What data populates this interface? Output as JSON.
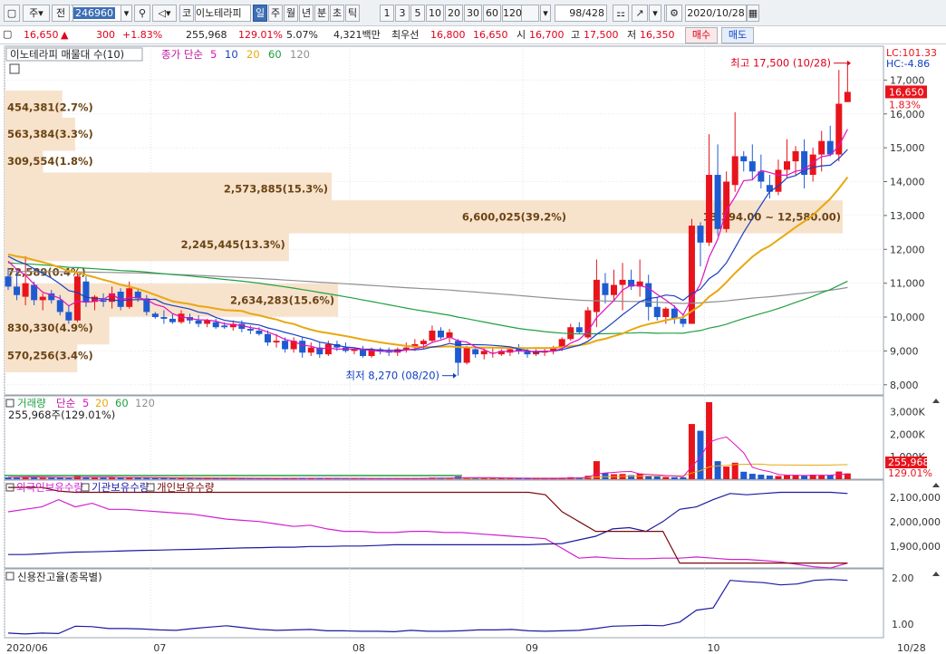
{
  "toolbar": {
    "period_select": "주",
    "view_select": "전",
    "stock_code": "246960",
    "market_button": "코",
    "stock_name": "이노테라피",
    "periods": [
      "일",
      "주",
      "월",
      "년",
      "분",
      "초",
      "틱"
    ],
    "active_period": "일",
    "intervals": [
      "1",
      "3",
      "5",
      "10",
      "20",
      "30",
      "60",
      "120"
    ],
    "count": "98",
    "total": "/428",
    "date": "2020/10/28"
  },
  "quote": {
    "price": "16,650",
    "change": "300",
    "change_pct": "+1.83%",
    "volume": "255,968",
    "volume_ratio": "129.01%",
    "turnover_pct": "5.07%",
    "amount": "4,321백만",
    "best_ask_label": "최우선",
    "best_ask": "16,800",
    "best_bid": "16,650",
    "open_label": "시",
    "open": "16,700",
    "high_label": "고",
    "high": "17,500",
    "low_label": "저",
    "low": "16,350",
    "buy_label": "매수",
    "sell_label": "매도"
  },
  "price_panel": {
    "title": "이노테라피 매물대 수(10)",
    "ma_title": "종가 단순",
    "ma_periods": [
      "5",
      "10",
      "20",
      "60",
      "120"
    ],
    "lc_label": "LC:101.33",
    "hc_label": "HC:-4.86",
    "current_price_tag": "16,650",
    "current_pct": "1.83%",
    "high_annotation": "최고 17,500 (10/28)",
    "low_annotation": "최저 8,270 (08/20)",
    "range_annotation_tail": "13,394.00 ~ 12,580.00)"
  },
  "volume_panel": {
    "title": "거래량",
    "ma_title": "단순",
    "ma_periods": [
      "5",
      "20",
      "60",
      "120"
    ],
    "summary": "255,968주(129.01%)",
    "current_tag": "255,968",
    "current_pct": "129.01%"
  },
  "holdings_panel": {
    "labels": [
      "외국인보유수량",
      "기관보유수량",
      "개인보유수량"
    ],
    "colors": [
      "#d020d0",
      "#1a1aa0",
      "#7a0a0a"
    ]
  },
  "credit_panel": {
    "title": "신용잔고율(종목별)"
  },
  "x_axis": [
    "2020/06",
    "07",
    "08",
    "09",
    "10",
    "10/28"
  ],
  "colors": {
    "up": "#e8141c",
    "down": "#1e5bd0",
    "ma5": "#e010c0",
    "ma10": "#1a3fc0",
    "ma20": "#e8a810",
    "ma60": "#20a040",
    "ma120": "#909090",
    "profile": "#f7e2cc",
    "profile_text": "#6b4413"
  },
  "chart_data": [
    {
      "type": "candlestick",
      "title": "이노테라피 매물대 수(10)",
      "y_ticks": [
        8000,
        9000,
        10000,
        11000,
        12000,
        13000,
        14000,
        15000,
        16000,
        17000
      ],
      "ylim": [
        7700,
        18000
      ],
      "candles": [
        [
          11200,
          11450,
          10800,
          10900
        ],
        [
          10900,
          11400,
          10500,
          10650
        ],
        [
          10600,
          11800,
          10350,
          11000
        ],
        [
          10950,
          11050,
          10350,
          10500
        ],
        [
          10500,
          10700,
          10200,
          10600
        ],
        [
          10700,
          10800,
          10400,
          10500
        ],
        [
          10500,
          10650,
          10050,
          10150
        ],
        [
          10150,
          10350,
          9800,
          9900
        ],
        [
          9900,
          11350,
          9850,
          11200
        ],
        [
          11050,
          11200,
          10300,
          10450
        ],
        [
          10450,
          10650,
          10200,
          10600
        ],
        [
          10500,
          10700,
          10300,
          10450
        ],
        [
          10450,
          10900,
          10250,
          10700
        ],
        [
          10750,
          10850,
          10200,
          10300
        ],
        [
          10300,
          11050,
          10250,
          10850
        ],
        [
          10750,
          10850,
          10450,
          10550
        ],
        [
          10550,
          10650,
          10050,
          10150
        ],
        [
          10100,
          10150,
          9950,
          10000
        ],
        [
          10000,
          10200,
          9800,
          9950
        ],
        [
          9950,
          10100,
          9800,
          9850
        ],
        [
          9850,
          10200,
          9800,
          10100
        ],
        [
          10000,
          10100,
          9800,
          9900
        ],
        [
          9900,
          10050,
          9700,
          9800
        ],
        [
          9800,
          9950,
          9700,
          9900
        ],
        [
          9850,
          9950,
          9650,
          9700
        ],
        [
          9750,
          9850,
          9650,
          9700
        ],
        [
          9700,
          9900,
          9600,
          9800
        ],
        [
          9800,
          9900,
          9550,
          9650
        ],
        [
          9650,
          9750,
          9500,
          9600
        ],
        [
          9600,
          9700,
          9450,
          9500
        ],
        [
          9500,
          9600,
          9150,
          9250
        ],
        [
          9250,
          9500,
          9100,
          9300
        ],
        [
          9300,
          9400,
          8950,
          9050
        ],
        [
          9050,
          9400,
          8950,
          9300
        ],
        [
          9300,
          9400,
          8800,
          8950
        ],
        [
          8950,
          9250,
          8850,
          9100
        ],
        [
          9100,
          9250,
          8800,
          8900
        ],
        [
          8900,
          9300,
          8850,
          9200
        ],
        [
          9200,
          9300,
          9000,
          9100
        ],
        [
          9100,
          9250,
          8950,
          9000
        ],
        [
          9000,
          9100,
          8900,
          9050
        ],
        [
          9050,
          9150,
          8800,
          8850
        ],
        [
          8850,
          9100,
          8800,
          9050
        ],
        [
          9050,
          9100,
          8900,
          9000
        ],
        [
          9000,
          9100,
          8850,
          8950
        ],
        [
          8950,
          9100,
          8850,
          9050
        ],
        [
          9050,
          9250,
          8950,
          9100
        ],
        [
          9100,
          9350,
          9000,
          9200
        ],
        [
          9200,
          9350,
          9050,
          9300
        ],
        [
          9300,
          9750,
          9250,
          9600
        ],
        [
          9600,
          9700,
          9350,
          9400
        ],
        [
          9400,
          9650,
          9250,
          9550
        ],
        [
          9300,
          9350,
          8270,
          8650
        ],
        [
          8650,
          9150,
          8600,
          9100
        ],
        [
          9050,
          9100,
          8800,
          8900
        ],
        [
          8900,
          9100,
          8750,
          9000
        ],
        [
          8950,
          9100,
          8800,
          8950
        ],
        [
          8900,
          9050,
          8850,
          9000
        ],
        [
          8950,
          9100,
          8850,
          9050
        ],
        [
          9050,
          9200,
          8900,
          9000
        ],
        [
          9000,
          9050,
          8800,
          8900
        ],
        [
          8900,
          9050,
          8850,
          9000
        ],
        [
          8950,
          9100,
          8850,
          9000
        ],
        [
          9000,
          9150,
          8900,
          9100
        ],
        [
          9100,
          9400,
          9000,
          9350
        ],
        [
          9350,
          9800,
          9300,
          9700
        ],
        [
          9700,
          9850,
          9500,
          9550
        ],
        [
          9400,
          10300,
          9350,
          10200
        ],
        [
          10150,
          11700,
          9700,
          11100
        ],
        [
          11000,
          11300,
          10400,
          10650
        ],
        [
          10650,
          11400,
          10500,
          10950
        ],
        [
          10950,
          11600,
          10200,
          11100
        ],
        [
          11100,
          11400,
          10800,
          10900
        ],
        [
          10900,
          11700,
          10600,
          11050
        ],
        [
          11000,
          11250,
          9900,
          10300
        ],
        [
          10300,
          10600,
          9900,
          10000
        ],
        [
          10000,
          10300,
          9800,
          10250
        ],
        [
          10250,
          10350,
          9800,
          9950
        ],
        [
          9950,
          10100,
          9700,
          9800
        ],
        [
          9800,
          12900,
          9800,
          12700
        ],
        [
          12700,
          12800,
          11500,
          12200
        ],
        [
          12200,
          15400,
          12100,
          14200
        ],
        [
          14200,
          15100,
          12400,
          12600
        ],
        [
          12600,
          14300,
          12500,
          14000
        ],
        [
          13900,
          16050,
          13700,
          14750
        ],
        [
          14750,
          14900,
          14300,
          14600
        ],
        [
          14600,
          15100,
          14050,
          14300
        ],
        [
          14300,
          14800,
          13800,
          14000
        ],
        [
          13900,
          14200,
          13500,
          13700
        ],
        [
          13700,
          14650,
          13600,
          14350
        ],
        [
          14350,
          15250,
          14100,
          14600
        ],
        [
          14600,
          15050,
          14200,
          14900
        ],
        [
          14900,
          15250,
          13800,
          14200
        ],
        [
          14200,
          15000,
          14000,
          14800
        ],
        [
          14800,
          15500,
          14300,
          15200
        ],
        [
          15200,
          15650,
          14750,
          14800
        ],
        [
          14800,
          17300,
          14600,
          16300
        ],
        [
          16350,
          17500,
          16350,
          16650
        ]
      ],
      "volume_profile": [
        {
          "label": "454,381(2.7%)",
          "price": 16200
        },
        {
          "label": "563,384(3.3%)",
          "price": 15400
        },
        {
          "label": "309,554(1.8%)",
          "price": 14600
        },
        {
          "label": "2,573,885(15.3%)",
          "price": 13780
        },
        {
          "label": "6,600,025(39.2%)",
          "price": 12960
        },
        {
          "label": "2,245,445(13.3%)",
          "price": 12140
        },
        {
          "label": "72,589(0.4%)",
          "price": 11320
        },
        {
          "label": "2,634,283(15.6%)",
          "price": 10500
        },
        {
          "label": "830,330(4.9%)",
          "price": 9680
        },
        {
          "label": "570,256(3.4%)",
          "price": 8860
        }
      ]
    },
    {
      "type": "bar",
      "title": "거래량",
      "y_ticks": [
        1000,
        2000,
        3000
      ],
      "y_tick_labels": [
        "1,000K",
        "2,000K",
        "3,000K"
      ],
      "values_k": [
        80,
        90,
        110,
        100,
        60,
        70,
        60,
        50,
        150,
        90,
        70,
        60,
        80,
        70,
        90,
        60,
        55,
        45,
        50,
        40,
        45,
        40,
        35,
        40,
        35,
        35,
        40,
        35,
        30,
        30,
        35,
        35,
        40,
        45,
        45,
        35,
        35,
        45,
        35,
        35,
        30,
        35,
        35,
        30,
        30,
        30,
        35,
        40,
        40,
        70,
        50,
        50,
        120,
        80,
        60,
        50,
        45,
        40,
        40,
        40,
        35,
        35,
        35,
        40,
        55,
        90,
        70,
        150,
        800,
        270,
        220,
        230,
        180,
        250,
        160,
        120,
        100,
        90,
        80,
        2450,
        2150,
        3420,
        800,
        560,
        730,
        330,
        240,
        200,
        160,
        140,
        170,
        190,
        160,
        200,
        170,
        180,
        340,
        256
      ]
    },
    {
      "type": "line",
      "series": [
        {
          "name": "외국인보유수량",
          "values": [
            2040000,
            2050000,
            2060000,
            2090000,
            2060000,
            2075000,
            2050000,
            2050000,
            2045000,
            2040000,
            2035000,
            2030000,
            2020000,
            2010000,
            2005000,
            2000000,
            1990000,
            1980000,
            1985000,
            1970000,
            1960000,
            1960000,
            1955000,
            1955000,
            1960000,
            1960000,
            1955000,
            1955000,
            1950000,
            1945000,
            1940000,
            1935000,
            1930000,
            1890000,
            1850000,
            1855000,
            1850000,
            1848000,
            1848000,
            1850000,
            1850000,
            1855000,
            1850000,
            1845000,
            1845000,
            1840000,
            1835000,
            1825000,
            1815000,
            1810000,
            1830000
          ]
        },
        {
          "name": "기관보유수량",
          "values": [
            1865000,
            1865000,
            1868000,
            1872000,
            1875000,
            1876000,
            1878000,
            1880000,
            1882000,
            1883000,
            1885000,
            1886000,
            1888000,
            1890000,
            1892000,
            1893000,
            1895000,
            1895000,
            1898000,
            1898000,
            1900000,
            1900000,
            1902000,
            1905000,
            1905000,
            1905000,
            1905000,
            1905000,
            1905000,
            1905000,
            1905000,
            1905000,
            1908000,
            1910000,
            1925000,
            1940000,
            1970000,
            1975000,
            1960000,
            2000000,
            2050000,
            2060000,
            2090000,
            2115000,
            2110000,
            2115000,
            2120000,
            2120000,
            2120000,
            2120000,
            2115000
          ]
        },
        {
          "name": "개인보유수량",
          "values": [
            2140000,
            2140000,
            2140000,
            2125000,
            2120000,
            2120000,
            2120000,
            2120000,
            2120000,
            2120000,
            2120000,
            2120000,
            2120000,
            2120000,
            2120000,
            2120000,
            2120000,
            2120000,
            2120000,
            2120000,
            2120000,
            2120000,
            2120000,
            2120000,
            2120000,
            2120000,
            2120000,
            2120000,
            2120000,
            2120000,
            2120000,
            2120000,
            2110000,
            2040000,
            2000000,
            1960000,
            1960000,
            1960000,
            1960000,
            1960000,
            1830000,
            1830000,
            1830000,
            1830000,
            1830000,
            1830000,
            1830000,
            1830000,
            1830000,
            1830000,
            1830000
          ]
        }
      ],
      "y_ticks": [
        1900000,
        2000000,
        2100000
      ],
      "y_tick_labels": [
        "1,900,000",
        "2,000,000",
        "2,100,000"
      ]
    },
    {
      "type": "line",
      "title": "신용잔고율(종목별)",
      "y_ticks": [
        1.0,
        2.0
      ],
      "y_tick_labels": [
        "1.00",
        "2.00"
      ],
      "values": [
        0.8,
        0.78,
        0.8,
        0.79,
        0.95,
        0.94,
        0.9,
        0.9,
        0.89,
        0.87,
        0.86,
        0.9,
        0.93,
        0.96,
        0.92,
        0.88,
        0.86,
        0.87,
        0.88,
        0.85,
        0.85,
        0.84,
        0.84,
        0.83,
        0.86,
        0.84,
        0.84,
        0.85,
        0.87,
        0.87,
        0.88,
        0.85,
        0.84,
        0.85,
        0.86,
        0.9,
        0.95,
        0.96,
        0.97,
        0.96,
        1.04,
        1.3,
        1.35,
        1.95,
        1.92,
        1.9,
        1.85,
        1.87,
        1.95,
        1.97,
        1.95
      ]
    }
  ]
}
